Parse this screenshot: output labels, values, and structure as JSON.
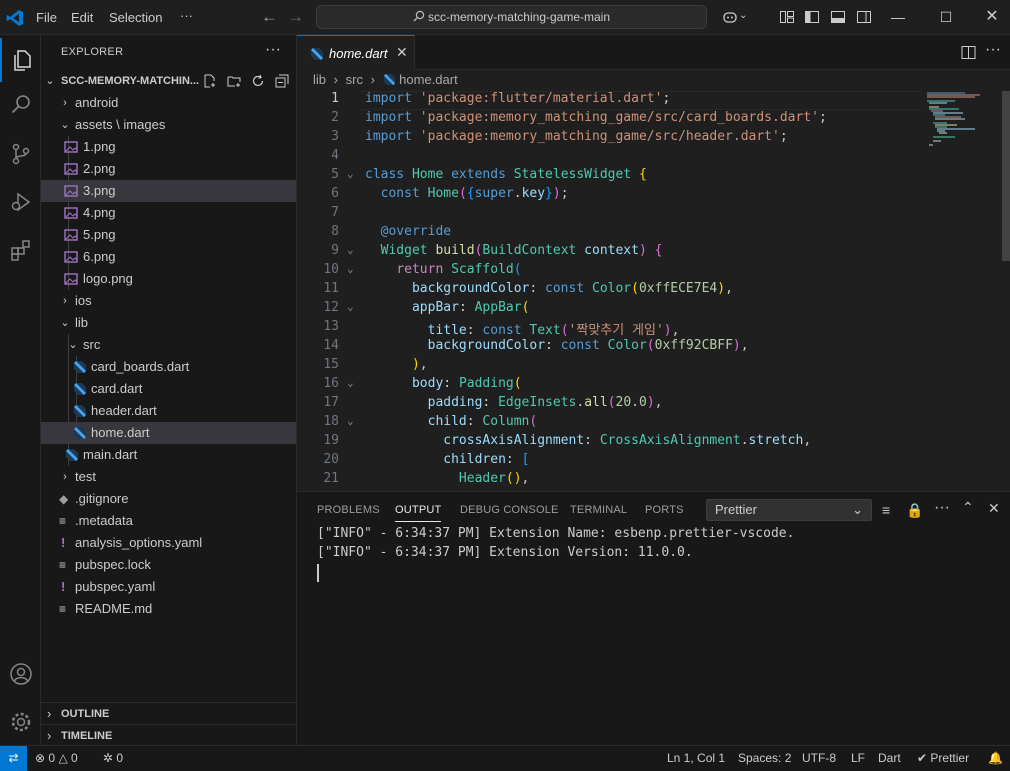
{
  "window": {
    "title": "scc-memory-matching-game-main",
    "menu": [
      "File",
      "Edit",
      "Selection",
      "···"
    ]
  },
  "explorer": {
    "header": "EXPLORER",
    "project": "SCC-MEMORY-MATCHIN...",
    "items": [
      {
        "label": "android",
        "type": "folder",
        "expanded": false
      },
      {
        "label": "assets \\ images",
        "type": "folder",
        "expanded": true
      },
      {
        "label": "1.png",
        "type": "image"
      },
      {
        "label": "2.png",
        "type": "image"
      },
      {
        "label": "3.png",
        "type": "image"
      },
      {
        "label": "4.png",
        "type": "image"
      },
      {
        "label": "5.png",
        "type": "image"
      },
      {
        "label": "6.png",
        "type": "image"
      },
      {
        "label": "logo.png",
        "type": "image"
      },
      {
        "label": "ios",
        "type": "folder",
        "expanded": false
      },
      {
        "label": "lib",
        "type": "folder",
        "expanded": true
      },
      {
        "label": "src",
        "type": "folder",
        "expanded": true
      },
      {
        "label": "card_boards.dart",
        "type": "dart"
      },
      {
        "label": "card.dart",
        "type": "dart"
      },
      {
        "label": "header.dart",
        "type": "dart"
      },
      {
        "label": "home.dart",
        "type": "dart"
      },
      {
        "label": "main.dart",
        "type": "dart"
      },
      {
        "label": "test",
        "type": "folder",
        "expanded": false
      },
      {
        "label": ".gitignore",
        "type": "git"
      },
      {
        "label": ".metadata",
        "type": "text"
      },
      {
        "label": "analysis_options.yaml",
        "type": "yaml"
      },
      {
        "label": "pubspec.lock",
        "type": "text"
      },
      {
        "label": "pubspec.yaml",
        "type": "yaml"
      },
      {
        "label": "README.md",
        "type": "text"
      }
    ],
    "outline": "OUTLINE",
    "timeline": "TIMELINE"
  },
  "editor": {
    "tab": "home.dart",
    "breadcrumb": [
      "lib",
      "src",
      "home.dart"
    ],
    "current_line": 1,
    "lines": [
      "import 'package:flutter/material.dart';",
      "import 'package:memory_matching_game/src/card_boards.dart';",
      "import 'package:memory_matching_game/src/header.dart';",
      "",
      "class Home extends StatelessWidget {",
      "  const Home({super.key});",
      "",
      "  @override",
      "  Widget build(BuildContext context) {",
      "    return Scaffold(",
      "      backgroundColor: const Color(0xffECE7E4),",
      "      appBar: AppBar(",
      "        title: const Text('짝맞추기 게임'),",
      "        backgroundColor: const Color(0xff92CBFF),",
      "      ),",
      "      body: Padding(",
      "        padding: EdgeInsets.all(20.0),",
      "        child: Column(",
      "          crossAxisAlignment: CrossAxisAlignment.stretch,",
      "          children: [",
      "            Header(),"
    ]
  },
  "panel": {
    "tabs": [
      "PROBLEMS",
      "OUTPUT",
      "DEBUG CONSOLE",
      "TERMINAL",
      "PORTS"
    ],
    "active_tab": "OUTPUT",
    "channel": "Prettier",
    "output": [
      "[\"INFO\" - 6:34:37 PM] Extension Name: esbenp.prettier-vscode.",
      "[\"INFO\" - 6:34:37 PM] Extension Version: 11.0.0."
    ]
  },
  "status": {
    "errors": "0",
    "warnings": "0",
    "ports": "0",
    "position": "Ln 1, Col 1",
    "spaces": "Spaces: 2",
    "encoding": "UTF-8",
    "eol": "LF",
    "language": "Dart",
    "formatter": "Prettier"
  },
  "colors": {
    "accent": "#0078d4",
    "selection": "#37373d",
    "editor_bg": "#1f1f1f",
    "sidebar_bg": "#181818"
  }
}
